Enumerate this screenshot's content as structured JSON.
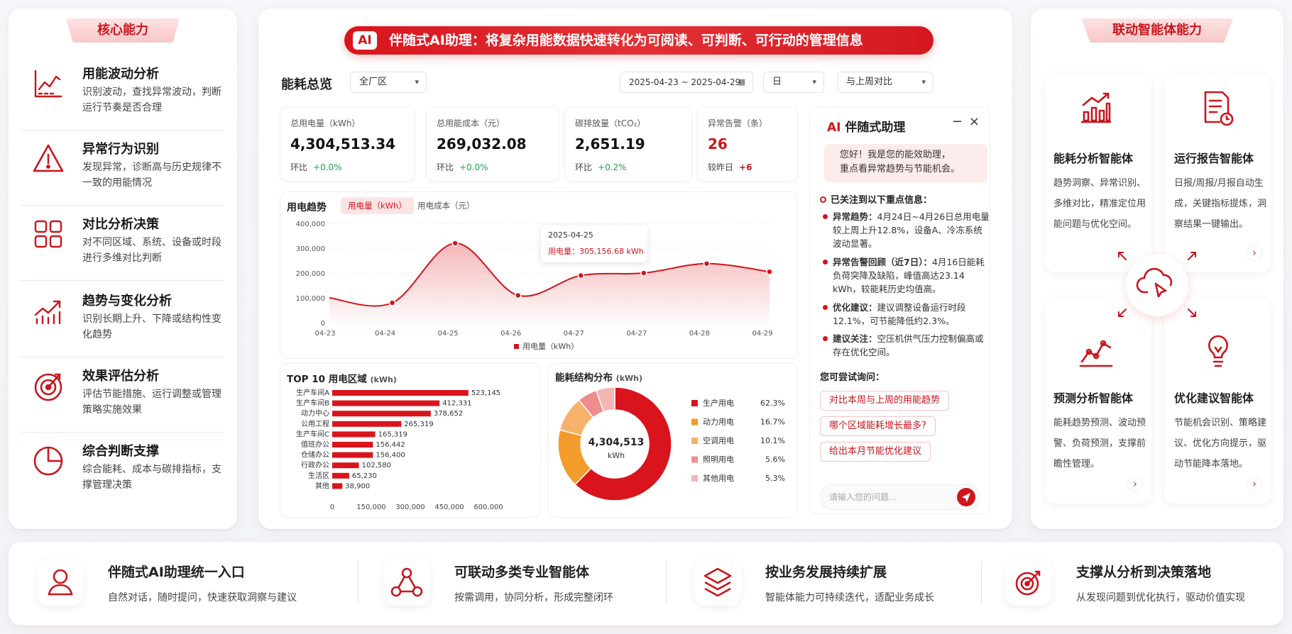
{
  "left": {
    "title": "核心能力",
    "items": [
      {
        "icon": "line-chart-icon",
        "title": "用能波动分析",
        "desc": "识别波动，查找异常波动，判断运行节奏是否合理"
      },
      {
        "icon": "warning-icon",
        "title": "异常行为识别",
        "desc": "发现异常，诊断高与历史规律不一致的用能情况"
      },
      {
        "icon": "grid-icon",
        "title": "对比分析决策",
        "desc": "对不同区域、系统、设备或时段进行多维对比判断"
      },
      {
        "icon": "trend-bar-icon",
        "title": "趋势与变化分析",
        "desc": "识别长期上升、下降或结构性变化趋势"
      },
      {
        "icon": "target-icon",
        "title": "效果评估分析",
        "desc": "评估节能措施、运行调整或管理策略实施效果"
      },
      {
        "icon": "pie-icon",
        "title": "综合判断支撑",
        "desc": "综合能耗、成本与碳排指标，支撑管理决策"
      }
    ]
  },
  "banner": {
    "badge": "AI",
    "text": "伴随式AI助理：将复杂用能数据快速转化为可阅读、可判断、可行动的管理信息"
  },
  "overview": {
    "title": "能耗总览",
    "area": "全厂区",
    "date_range": "2025-04-23 ~ 2025-04-29",
    "granularity": "日",
    "compare": "与上周对比"
  },
  "kpis": [
    {
      "label": "总用电量（kWh）",
      "value": "4,304,513.34",
      "change_label": "环比",
      "change": "+0.0%"
    },
    {
      "label": "总用能成本（元）",
      "value": "269,032.08",
      "change_label": "环比",
      "change": "+0.0%"
    },
    {
      "label": "碳排放量（tCO₂）",
      "value": "2,651.19",
      "change_label": "环比",
      "change": "+0.2%"
    },
    {
      "label": "异常告警（条）",
      "value": "26",
      "change_label": "较昨日",
      "change": "+6"
    }
  ],
  "trend": {
    "title": "用电趋势",
    "tab_active": "用电量（kWh）",
    "tab_other": "用电成本（元）",
    "tooltip_date": "2025-04-25",
    "tooltip_value": "用电量：305,156.68 kWh",
    "legend": "用电量（kWh）",
    "colors": {
      "line": "#d0151c"
    }
  },
  "top10": {
    "title": "TOP 10 用电区域",
    "unit": "(kWh)"
  },
  "structure": {
    "title": "能耗结构分布",
    "unit": "(kWh)",
    "center_value": "4,304,513",
    "center_unit": "kWh"
  },
  "chart_data": [
    {
      "type": "area",
      "x": [
        "04-23",
        "04-24",
        "04-25",
        "04-26",
        "04-27",
        "04-27",
        "04-28",
        "04-29"
      ],
      "series": [
        {
          "name": "用电量（kWh）",
          "values": [
            100000,
            80000,
            320000,
            110000,
            190000,
            200000,
            238000,
            205000
          ]
        }
      ],
      "ylim": [
        0,
        400000
      ],
      "yticks": [
        "0",
        "100,000",
        "200,000",
        "300,000",
        "400,000"
      ],
      "grid": true
    },
    {
      "type": "bar",
      "categories": [
        "生产车间A",
        "生产车间B",
        "动力中心",
        "公用工程",
        "生产车间C",
        "值班办公",
        "仓储办公",
        "行政办公",
        "生活区",
        "其他"
      ],
      "values": [
        523145,
        412331,
        378652,
        265319,
        165319,
        156442,
        156400,
        102580,
        65230,
        38900
      ],
      "labels": [
        "523,145",
        "412,331",
        "378,652",
        "265,319",
        "165,319",
        "156,442",
        "156,400",
        "102,580",
        "65,230",
        "38,900"
      ],
      "xlim": [
        0,
        600000
      ],
      "xticks": [
        "0",
        "150,000",
        "300,000",
        "450,000",
        "600,000"
      ]
    },
    {
      "type": "pie",
      "labels": [
        "生产用电",
        "动力用电",
        "空调用电",
        "照明用电",
        "其他用电"
      ],
      "values": [
        62.3,
        16.7,
        10.1,
        5.6,
        5.3
      ],
      "value_labels": [
        "62.3%",
        "16.7%",
        "10.1%",
        "5.6%",
        "5.3%"
      ],
      "colors": [
        "#d9141c",
        "#f39b2b",
        "#f6b26a",
        "#f08c8c",
        "#f4b5b5"
      ]
    }
  ],
  "chat": {
    "title_ai": "AI",
    "title": "伴随式助理",
    "greeting_1": "您好！我是您的能效助理，",
    "greeting_2": "重点看异常趋势与节能机会。",
    "focus": "已关注到以下重点信息：",
    "points": [
      {
        "head": "异常趋势：",
        "body": "4月24日~4月26日总用电量较上周上升12.8%，设备A、冷冻系统波动显著。"
      },
      {
        "head": "异常告警回顾（近7日）：",
        "body": "4月16日能耗负荷突降及缺陷，峰值高达23.14 kWh，较能耗历史均值高。"
      },
      {
        "head": "优化建议：",
        "body": "建议调整设备运行时段12.1%，可节能降低约2.3%。"
      },
      {
        "head": "建议关注：",
        "body": "空压机供气压力控制偏高或存在优化空间。"
      }
    ],
    "try_label": "您可尝试询问：",
    "suggestions": [
      "对比本周与上周的用能趋势",
      "哪个区域能耗增长最多?",
      "给出本月节能优化建议"
    ],
    "input_placeholder": "请输入您的问题..."
  },
  "right": {
    "title": "联动智能体能力",
    "agents": [
      {
        "icon": "analysis-icon",
        "title": "能耗分析智能体",
        "desc": "趋势洞察、异常识别、多维对比，精准定位用能问题与优化空间。"
      },
      {
        "icon": "report-icon",
        "title": "运行报告智能体",
        "desc": "日报/周报/月报自动生成，关键指标提炼，洞察结果一键输出。"
      },
      {
        "icon": "forecast-icon",
        "title": "预测分析智能体",
        "desc": "能耗趋势预测、波动预警、负荷预测，支撑前瞻性管理。"
      },
      {
        "icon": "bulb-icon",
        "title": "优化建议智能体",
        "desc": "节能机会识别、策略建议、优化方向提示，驱动节能降本落地。"
      }
    ]
  },
  "bottom": [
    {
      "icon": "user-icon",
      "title": "伴随式AI助理统一入口",
      "desc": "自然对话，随时提问，快速获取洞察与建议"
    },
    {
      "icon": "network-icon",
      "title": "可联动多类专业智能体",
      "desc": "按需调用，协同分析，形成完整闭环"
    },
    {
      "icon": "layers-icon",
      "title": "按业务发展持续扩展",
      "desc": "智能体能力可持续迭代，适配业务成长"
    },
    {
      "icon": "target-icon",
      "title": "支撑从分析到决策落地",
      "desc": "从发现问题到优化执行，驱动价值实现"
    }
  ]
}
